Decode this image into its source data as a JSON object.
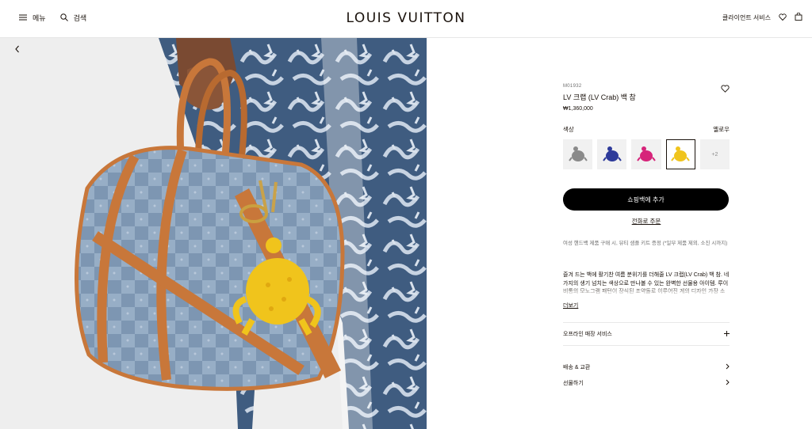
{
  "header": {
    "menu_label": "메뉴",
    "search_label": "검색",
    "logo": "LOUIS VUITTON",
    "client_service_label": "클라이언트 서비스"
  },
  "product": {
    "sku": "M01932",
    "title": "LV 크랩 (LV Crab) 백 참",
    "price": "₩1,360,000",
    "colors_label": "색상",
    "selected_color": "옐로우",
    "swatches": [
      {
        "color": "#8a8a8a",
        "name": "gray-crab-swatch"
      },
      {
        "color": "#2d3a9a",
        "name": "blue-crab-swatch"
      },
      {
        "color": "#d6247a",
        "name": "pink-crab-swatch"
      },
      {
        "color": "#f0c41c",
        "name": "yellow-crab-swatch"
      }
    ],
    "more_swatches": "+2",
    "add_to_bag": "쇼핑백에 추가",
    "order_link": "전화로 주문",
    "promo": "여성 핸드백 제품 구매 시, 뷰티 샘플 키트 증정 (*일부 제품 제외, 소진 시까지)",
    "description": "즐겨 드는 백에 활기찬 여름 분위기를 더해줄 LV 크랩(LV Crab) 백 참. 네 가지의 생기 넘치는 색상으로 만나볼 수 있는 완벽한 선물용 아이템. 루이 비통의 모노그램 패턴이 장식된 조약돌로 이루어진 게의 디자인 가장 소재 ...",
    "more_label": "더보기",
    "service_label": "오프라인 매장 서비스",
    "shipping_label": "배송 & 교환",
    "gift_label": "선물하기"
  },
  "colors": {
    "accent": "#19110b",
    "cta_bg": "#000000",
    "denim": "#8fa6be",
    "leather": "#c8773a",
    "charm": "#f0c41c"
  }
}
